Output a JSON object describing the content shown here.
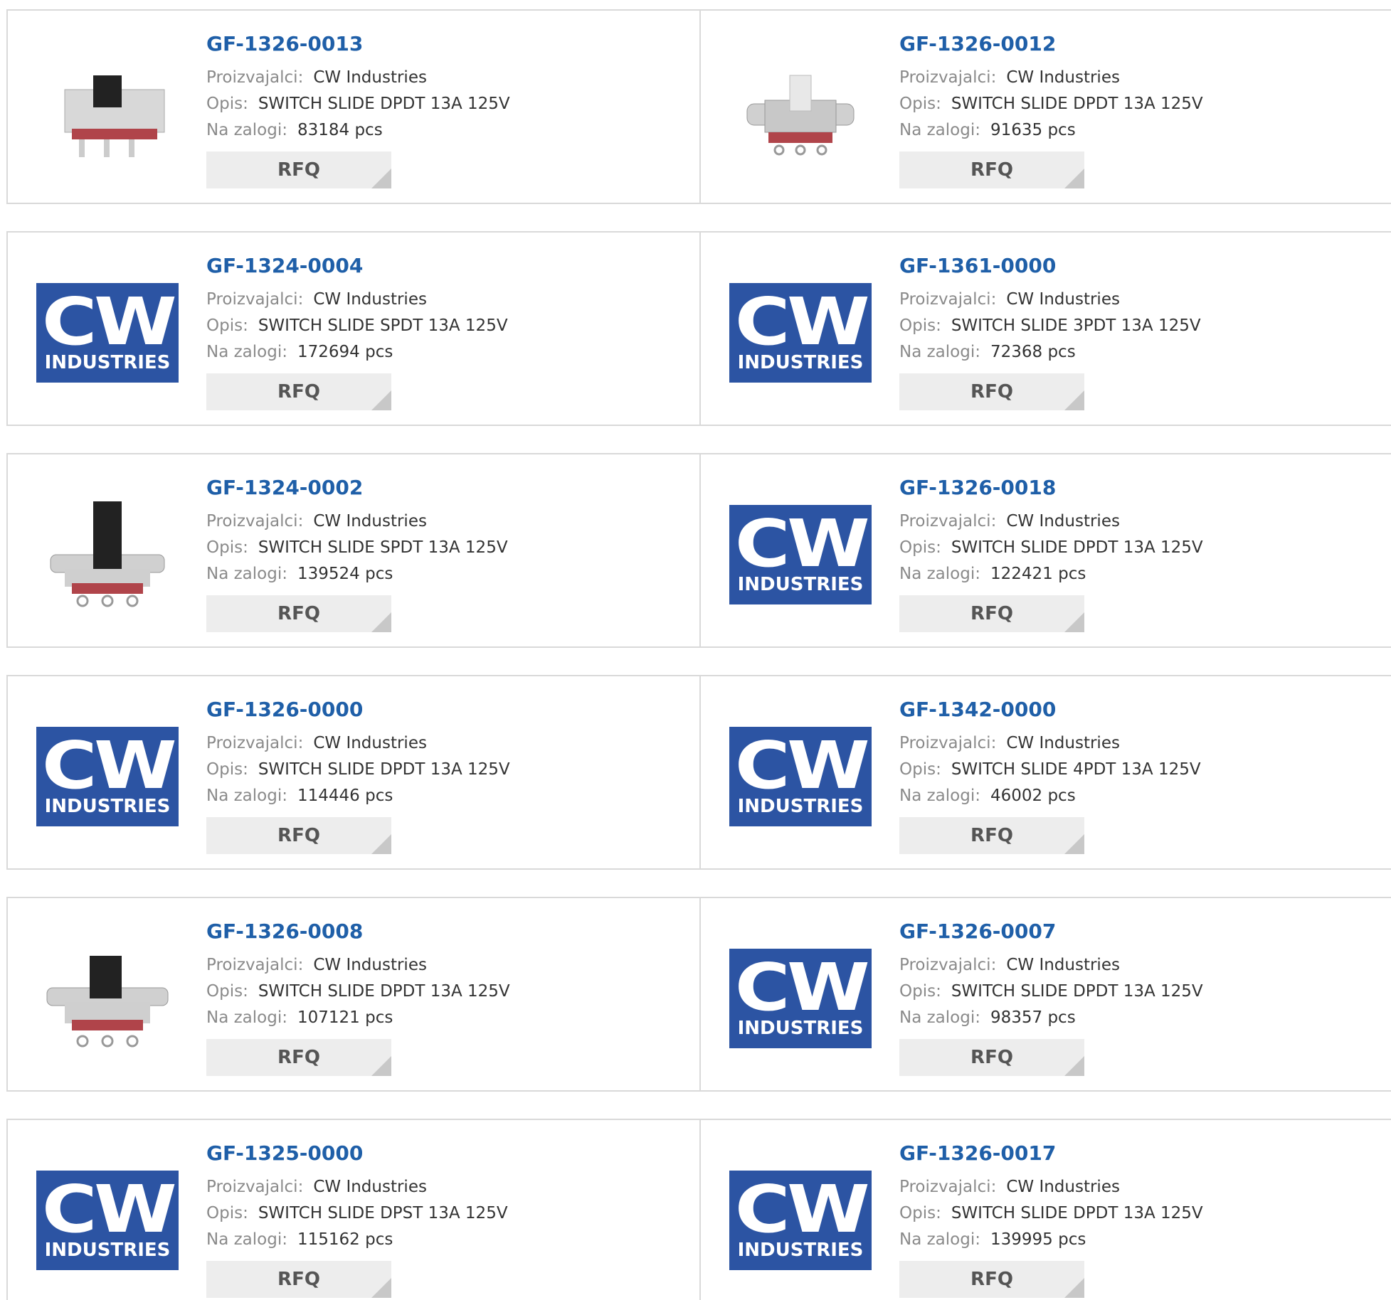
{
  "labels": {
    "manufacturer": "Proizvajalci:",
    "description": "Opis:",
    "stock": "Na zalogi:",
    "rfq": "RFQ"
  },
  "logo": {
    "cw": "CW",
    "industries": "INDUSTRIES"
  },
  "colors": {
    "part_link": "#1f5fa8",
    "logo_bg": "#2c54a3",
    "button_bg": "#ededed"
  },
  "products": [
    {
      "part": "GF-1326-0013",
      "manufacturer": "CW Industries",
      "description": "SWITCH SLIDE DPDT 13A 125V",
      "stock": "83184 pcs",
      "image": "switch-photo"
    },
    {
      "part": "GF-1326-0012",
      "manufacturer": "CW Industries",
      "description": "SWITCH SLIDE DPDT 13A 125V",
      "stock": "91635 pcs",
      "image": "switch-photo"
    },
    {
      "part": "GF-1324-0004",
      "manufacturer": "CW Industries",
      "description": "SWITCH SLIDE SPDT 13A 125V",
      "stock": "172694 pcs",
      "image": "cw-logo"
    },
    {
      "part": "GF-1361-0000",
      "manufacturer": "CW Industries",
      "description": "SWITCH SLIDE 3PDT 13A 125V",
      "stock": "72368 pcs",
      "image": "cw-logo"
    },
    {
      "part": "GF-1324-0002",
      "manufacturer": "CW Industries",
      "description": "SWITCH SLIDE SPDT 13A 125V",
      "stock": "139524 pcs",
      "image": "switch-photo"
    },
    {
      "part": "GF-1326-0018",
      "manufacturer": "CW Industries",
      "description": "SWITCH SLIDE DPDT 13A 125V",
      "stock": "122421 pcs",
      "image": "cw-logo"
    },
    {
      "part": "GF-1326-0000",
      "manufacturer": "CW Industries",
      "description": "SWITCH SLIDE DPDT 13A 125V",
      "stock": "114446 pcs",
      "image": "cw-logo"
    },
    {
      "part": "GF-1342-0000",
      "manufacturer": "CW Industries",
      "description": "SWITCH SLIDE 4PDT 13A 125V",
      "stock": "46002 pcs",
      "image": "cw-logo"
    },
    {
      "part": "GF-1326-0008",
      "manufacturer": "CW Industries",
      "description": "SWITCH SLIDE DPDT 13A 125V",
      "stock": "107121 pcs",
      "image": "switch-photo"
    },
    {
      "part": "GF-1326-0007",
      "manufacturer": "CW Industries",
      "description": "SWITCH SLIDE DPDT 13A 125V",
      "stock": "98357 pcs",
      "image": "cw-logo"
    },
    {
      "part": "GF-1325-0000",
      "manufacturer": "CW Industries",
      "description": "SWITCH SLIDE DPST 13A 125V",
      "stock": "115162 pcs",
      "image": "cw-logo"
    },
    {
      "part": "GF-1326-0017",
      "manufacturer": "CW Industries",
      "description": "SWITCH SLIDE DPDT 13A 125V",
      "stock": "139995 pcs",
      "image": "cw-logo"
    }
  ]
}
